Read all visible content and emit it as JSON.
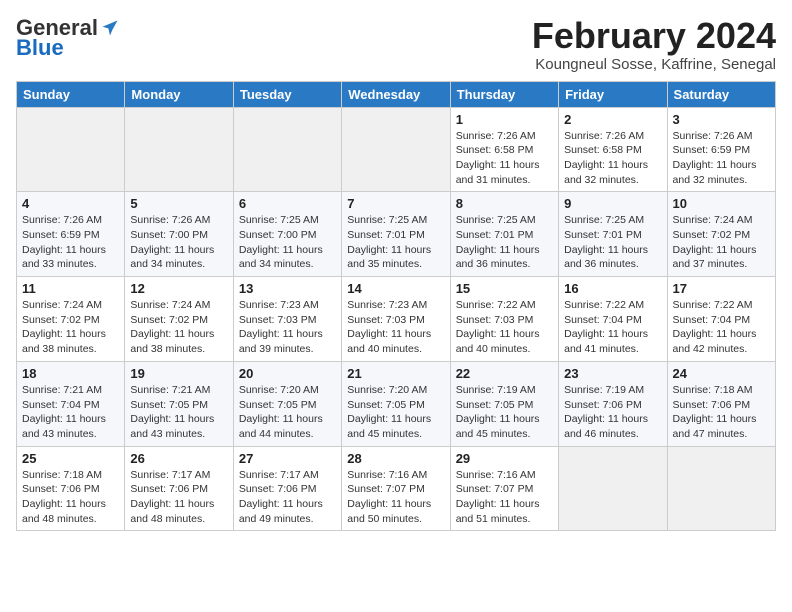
{
  "header": {
    "logo_general": "General",
    "logo_blue": "Blue",
    "title": "February 2024",
    "subtitle": "Koungneul Sosse, Kaffrine, Senegal"
  },
  "weekdays": [
    "Sunday",
    "Monday",
    "Tuesday",
    "Wednesday",
    "Thursday",
    "Friday",
    "Saturday"
  ],
  "weeks": [
    [
      {
        "day": "",
        "info": ""
      },
      {
        "day": "",
        "info": ""
      },
      {
        "day": "",
        "info": ""
      },
      {
        "day": "",
        "info": ""
      },
      {
        "day": "1",
        "info": "Sunrise: 7:26 AM\nSunset: 6:58 PM\nDaylight: 11 hours and 31 minutes."
      },
      {
        "day": "2",
        "info": "Sunrise: 7:26 AM\nSunset: 6:58 PM\nDaylight: 11 hours and 32 minutes."
      },
      {
        "day": "3",
        "info": "Sunrise: 7:26 AM\nSunset: 6:59 PM\nDaylight: 11 hours and 32 minutes."
      }
    ],
    [
      {
        "day": "4",
        "info": "Sunrise: 7:26 AM\nSunset: 6:59 PM\nDaylight: 11 hours and 33 minutes."
      },
      {
        "day": "5",
        "info": "Sunrise: 7:26 AM\nSunset: 7:00 PM\nDaylight: 11 hours and 34 minutes."
      },
      {
        "day": "6",
        "info": "Sunrise: 7:25 AM\nSunset: 7:00 PM\nDaylight: 11 hours and 34 minutes."
      },
      {
        "day": "7",
        "info": "Sunrise: 7:25 AM\nSunset: 7:01 PM\nDaylight: 11 hours and 35 minutes."
      },
      {
        "day": "8",
        "info": "Sunrise: 7:25 AM\nSunset: 7:01 PM\nDaylight: 11 hours and 36 minutes."
      },
      {
        "day": "9",
        "info": "Sunrise: 7:25 AM\nSunset: 7:01 PM\nDaylight: 11 hours and 36 minutes."
      },
      {
        "day": "10",
        "info": "Sunrise: 7:24 AM\nSunset: 7:02 PM\nDaylight: 11 hours and 37 minutes."
      }
    ],
    [
      {
        "day": "11",
        "info": "Sunrise: 7:24 AM\nSunset: 7:02 PM\nDaylight: 11 hours and 38 minutes."
      },
      {
        "day": "12",
        "info": "Sunrise: 7:24 AM\nSunset: 7:02 PM\nDaylight: 11 hours and 38 minutes."
      },
      {
        "day": "13",
        "info": "Sunrise: 7:23 AM\nSunset: 7:03 PM\nDaylight: 11 hours and 39 minutes."
      },
      {
        "day": "14",
        "info": "Sunrise: 7:23 AM\nSunset: 7:03 PM\nDaylight: 11 hours and 40 minutes."
      },
      {
        "day": "15",
        "info": "Sunrise: 7:22 AM\nSunset: 7:03 PM\nDaylight: 11 hours and 40 minutes."
      },
      {
        "day": "16",
        "info": "Sunrise: 7:22 AM\nSunset: 7:04 PM\nDaylight: 11 hours and 41 minutes."
      },
      {
        "day": "17",
        "info": "Sunrise: 7:22 AM\nSunset: 7:04 PM\nDaylight: 11 hours and 42 minutes."
      }
    ],
    [
      {
        "day": "18",
        "info": "Sunrise: 7:21 AM\nSunset: 7:04 PM\nDaylight: 11 hours and 43 minutes."
      },
      {
        "day": "19",
        "info": "Sunrise: 7:21 AM\nSunset: 7:05 PM\nDaylight: 11 hours and 43 minutes."
      },
      {
        "day": "20",
        "info": "Sunrise: 7:20 AM\nSunset: 7:05 PM\nDaylight: 11 hours and 44 minutes."
      },
      {
        "day": "21",
        "info": "Sunrise: 7:20 AM\nSunset: 7:05 PM\nDaylight: 11 hours and 45 minutes."
      },
      {
        "day": "22",
        "info": "Sunrise: 7:19 AM\nSunset: 7:05 PM\nDaylight: 11 hours and 45 minutes."
      },
      {
        "day": "23",
        "info": "Sunrise: 7:19 AM\nSunset: 7:06 PM\nDaylight: 11 hours and 46 minutes."
      },
      {
        "day": "24",
        "info": "Sunrise: 7:18 AM\nSunset: 7:06 PM\nDaylight: 11 hours and 47 minutes."
      }
    ],
    [
      {
        "day": "25",
        "info": "Sunrise: 7:18 AM\nSunset: 7:06 PM\nDaylight: 11 hours and 48 minutes."
      },
      {
        "day": "26",
        "info": "Sunrise: 7:17 AM\nSunset: 7:06 PM\nDaylight: 11 hours and 48 minutes."
      },
      {
        "day": "27",
        "info": "Sunrise: 7:17 AM\nSunset: 7:06 PM\nDaylight: 11 hours and 49 minutes."
      },
      {
        "day": "28",
        "info": "Sunrise: 7:16 AM\nSunset: 7:07 PM\nDaylight: 11 hours and 50 minutes."
      },
      {
        "day": "29",
        "info": "Sunrise: 7:16 AM\nSunset: 7:07 PM\nDaylight: 11 hours and 51 minutes."
      },
      {
        "day": "",
        "info": ""
      },
      {
        "day": "",
        "info": ""
      }
    ]
  ]
}
